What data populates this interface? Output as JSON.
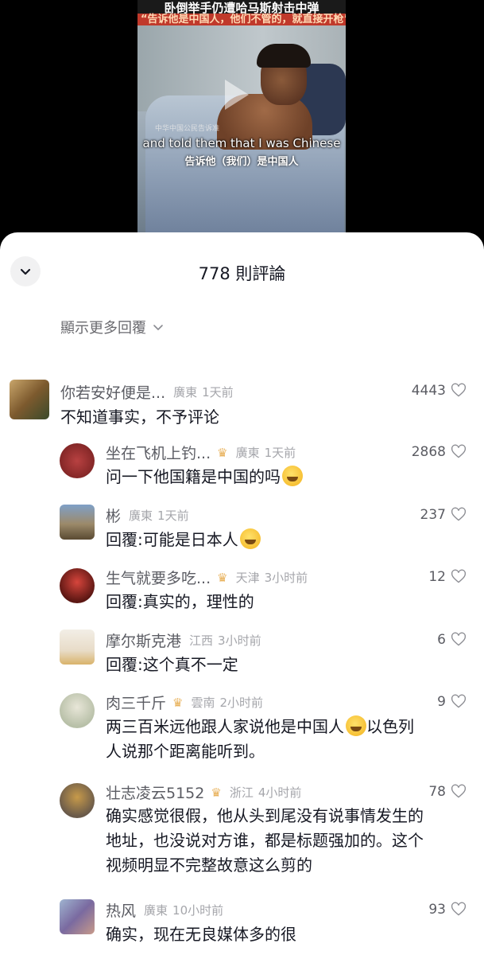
{
  "video": {
    "title": "卧倒举手仍遭哈马斯射击中弹",
    "subtitle": "“告诉他是中国人，他们不管的，就直接开枪”",
    "watermark": "中华中国公民告诉准",
    "caption_en": "and told them that I was Chinese",
    "caption_zh": "告诉他（我们）是中国人"
  },
  "sheet": {
    "title": "778 則評論",
    "more_replies": "顯示更多回覆"
  },
  "comments": [
    {
      "name": "你若安好便是...",
      "crown": false,
      "region": "廣東",
      "time": "1天前",
      "likes": "4443",
      "text": "不知道事实，不予评论",
      "emoji": false
    },
    {
      "name": "坐在飞机上钓...",
      "crown": true,
      "region": "廣東",
      "time": "1天前",
      "likes": "2868",
      "text": "问一下他国籍是中国的吗",
      "emoji": true
    },
    {
      "name": "彬",
      "crown": false,
      "region": "廣東",
      "time": "1天前",
      "likes": "237",
      "text": "回覆:可能是日本人",
      "emoji": true
    },
    {
      "name": "生气就要多吃...",
      "crown": true,
      "region": "天津",
      "time": "3小时前",
      "likes": "12",
      "text": "回覆:真实的，理性的",
      "emoji": false
    },
    {
      "name": "摩尔斯克港",
      "crown": false,
      "region": "江西",
      "time": "3小时前",
      "likes": "6",
      "text": "回覆:这个真不一定",
      "emoji": false
    },
    {
      "name": "肉三千斤",
      "crown": true,
      "region": "雲南",
      "time": "2小时前",
      "likes": "9",
      "text_line1": "两三百米远他跟人家说他是中国人",
      "text_line1b": "以色列",
      "text_line2": "人说那个距离能听到。",
      "emoji": true
    },
    {
      "name": "壮志凌云5152",
      "crown": true,
      "region": "浙江",
      "time": "4小时前",
      "likes": "78",
      "text_line1": "确实感觉很假，他从头到尾没有说事情发生的",
      "text_line2": "地址，也没说对方谁，都是标题强加的。这个",
      "text_line3": "视频明显不完整故意这么剪的",
      "emoji": false
    },
    {
      "name": "热风",
      "crown": false,
      "region": "廣東",
      "time": "10小时前",
      "likes": "93",
      "text": "确实，现在无良媒体多的很",
      "emoji": false
    }
  ],
  "colors": {
    "sheet_bg": "#ffffff",
    "name": "#5b5c63",
    "meta": "#a5a6ab",
    "text": "#161823",
    "crown": "#e8b15a"
  },
  "icons": {
    "collapse": "chevron-down-icon",
    "more": "chevron-down-icon",
    "like": "heart-outline-icon",
    "badge": "crown-icon"
  }
}
